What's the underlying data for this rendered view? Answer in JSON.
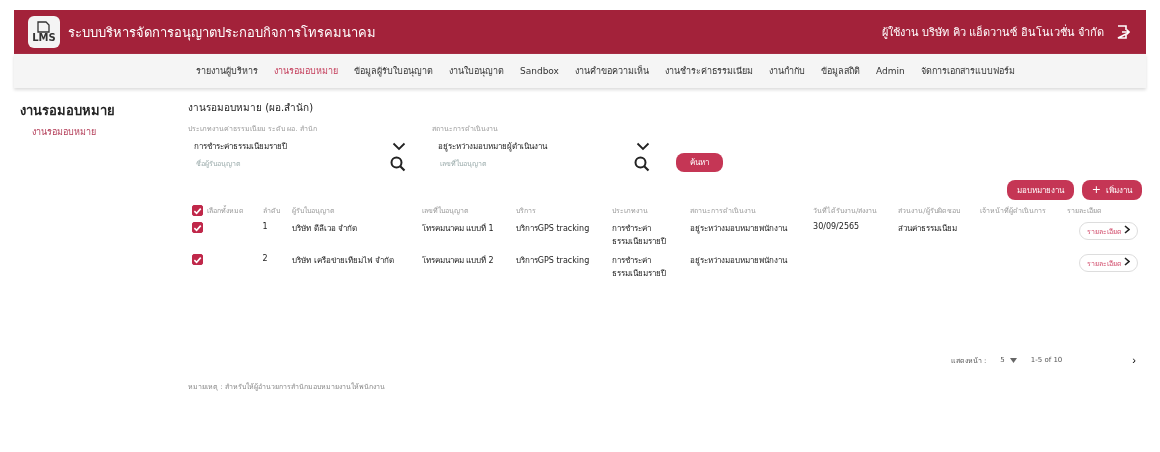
{
  "header": {
    "logo_text": "LMS",
    "title": "ระบบบริหารจัดการอนุญาตประกอบกิจการโทรคมนาคม",
    "user": "ผู้ใช้งาน บริษัท คิว แอ็ดวานซ์ อินโนเวชั่น จำกัด"
  },
  "nav": [
    {
      "label": "รายงานผู้บริหาร",
      "selected": false
    },
    {
      "label": "งานรอมอบหมาย",
      "selected": true
    },
    {
      "label": "ข้อมูลผู้รับใบอนุญาต",
      "selected": false
    },
    {
      "label": "งานใบอนุญาต",
      "selected": false
    },
    {
      "label": "Sandbox",
      "selected": false
    },
    {
      "label": "งานคำขอความเห็น",
      "selected": false
    },
    {
      "label": "งานชำระค่าธรรมเนียม",
      "selected": false
    },
    {
      "label": "งานกำกับ",
      "selected": false
    },
    {
      "label": "ข้อมูลสถิติ",
      "selected": false
    },
    {
      "label": "Admin",
      "selected": false
    },
    {
      "label": "จัดการเอกสารแบบฟอร์ม",
      "selected": false
    }
  ],
  "sidebar": {
    "title": "งานรอมอบหมาย",
    "items": [
      {
        "label": "งานรอมอบหมาย",
        "selected": true
      }
    ]
  },
  "page_title": "งานรอมอบหมาย (ผอ.สำนัก)",
  "filters": [
    {
      "label": "ประเภทงานค่าธรรมเนียม ระดับ ผอ. สำนัก",
      "value": "การชำระค่าธรรมเนียมรายปี",
      "placeholder": "ชื่อผู้รับอนุญาต"
    },
    {
      "label": "สถานะการดำเนินงาน",
      "value": "อยู่ระหว่างมอบหมายผู้ดำเนินงาน",
      "placeholder": "เลขที่ใบอนุญาต"
    }
  ],
  "search_button": "ค้นหา",
  "actions": [
    {
      "label": "มอบหมายงาน",
      "kind": "plain"
    },
    {
      "label": "เพิ่มงาน",
      "kind": "add",
      "icon": "+"
    }
  ],
  "table": {
    "select_all": {
      "label": "เลือกทั้งหมด",
      "checked": true
    },
    "columns": [
      "ลำดับ",
      "ผู้รับใบอนุญาต",
      "เลขที่ใบอนุญาต",
      "บริการ",
      "ประเภทงาน",
      "สถานะการดำเนินงาน",
      "วันที่ได้รับงาน/ส่งงาน",
      "ส่วนงาน/ผู้รับผิดชอบ",
      "เจ้าหน้าที่ผู้ดำเนินการ",
      "รายละเอียด"
    ],
    "rows": [
      {
        "checked": true,
        "cells": [
          "1",
          "บริษัท ดีลีเวอ จำกัด",
          "โทรคมนาคม แบบที่ 1",
          "บริการGPS tracking",
          "การชำระค่าธรรมเนียมรายปี",
          "อยู่ระหว่างมอบหมายพนักงาน",
          "30/09/2565",
          "ส่วนค่าธรรมเนียม",
          ""
        ],
        "detail": "รายละเอียด"
      },
      {
        "checked": true,
        "cells": [
          "2",
          "บริษัท เครือข่ายเทียมไฟ จำกัด",
          "โทรคมนาคม แบบที่ 2",
          "บริการGPS tracking",
          "การชำระค่าธรรมเนียมรายปี",
          "อยู่ระหว่างมอบหมายพนักงาน",
          "",
          "",
          ""
        ],
        "detail": "รายละเอียด"
      }
    ]
  },
  "pagination": {
    "label": "แสดงหน้า :",
    "per_page": "5",
    "range": "1-5 of 10",
    "next": "›"
  },
  "footnote": "หมายเหตุ : สำหรับให้ผู้อำนวยการสำนักมอบหมายงานให้พนักงาน"
}
